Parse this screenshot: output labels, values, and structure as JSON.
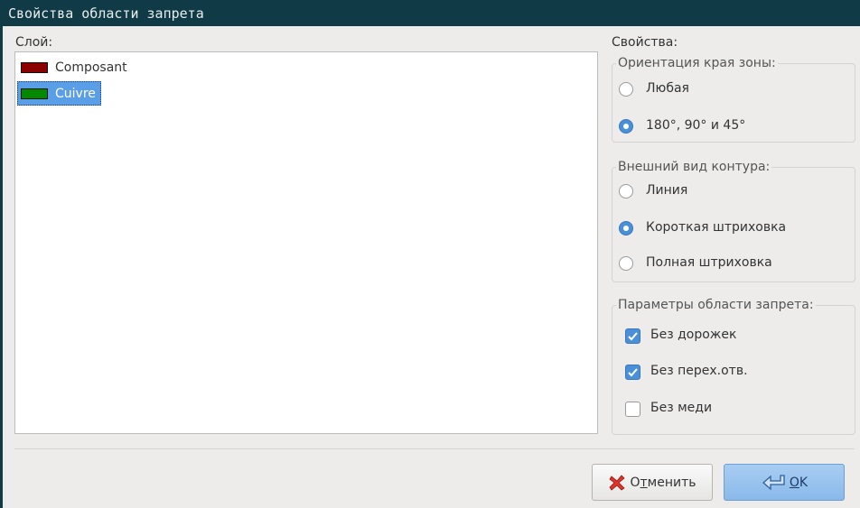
{
  "window": {
    "title": "Свойства области запрета"
  },
  "layer": {
    "label": "Слой:",
    "items": [
      {
        "name": "Composant",
        "color": "#8b0000",
        "selected": false
      },
      {
        "name": "Cuivre",
        "color": "#008800",
        "selected": true
      }
    ]
  },
  "properties": {
    "label": "Свойства:",
    "orientation": {
      "legend": "Ориентация края зоны:",
      "options": [
        {
          "label": "Любая",
          "selected": false
        },
        {
          "label": "180°, 90° и 45°",
          "selected": true
        }
      ]
    },
    "outline": {
      "legend": "Внешний вид контура:",
      "options": [
        {
          "label": "Линия",
          "selected": false
        },
        {
          "label": "Короткая штриховка",
          "selected": true
        },
        {
          "label": "Полная штриховка",
          "selected": false
        }
      ]
    },
    "keepout": {
      "legend": "Параметры области запрета:",
      "options": [
        {
          "label": "Без дорожек",
          "checked": true
        },
        {
          "label": "Без перех.отв.",
          "checked": true
        },
        {
          "label": "Без меди",
          "checked": false
        }
      ]
    }
  },
  "buttons": {
    "cancel": {
      "label_pre": "О",
      "label_accel": "т",
      "label_post": "менить",
      "icon": "red-x-icon"
    },
    "ok": {
      "label_accel": "O",
      "label_post": "K",
      "icon": "enter-arrow-icon"
    }
  }
}
